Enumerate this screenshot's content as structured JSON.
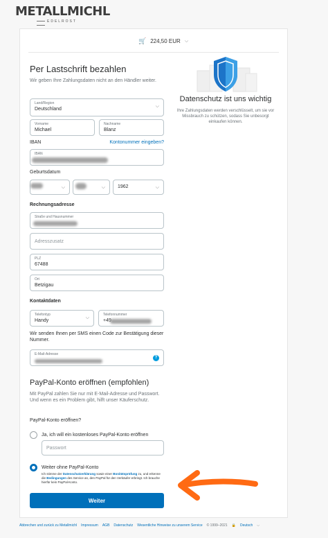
{
  "brand": {
    "name": "METALLMICHL",
    "tagline": "EDELROST"
  },
  "cart": {
    "amount": "224,50 EUR"
  },
  "form": {
    "title": "Per Lastschrift bezahlen",
    "intro": "Wir geben Ihre Zahlungsdaten nicht an den Händler weiter.",
    "country": {
      "label": "Land/Region",
      "value": "Deutschland"
    },
    "firstname": {
      "label": "Vorname",
      "value": "Michael"
    },
    "lastname": {
      "label": "Nachname",
      "value": "Blanz"
    },
    "iban_heading": "IBAN",
    "account_link": "Kontonummer eingeben?",
    "iban": {
      "label": "IBAN",
      "value": ""
    },
    "dob_heading": "Geburtsdatum",
    "dob_year": "1962",
    "billing_heading": "Rechnungsadresse",
    "street": {
      "label": "Straße und Hausnummer"
    },
    "address_extra": {
      "placeholder": "Adresszusatz"
    },
    "zip": {
      "label": "PLZ",
      "value": "67488"
    },
    "city": {
      "label": "Ort",
      "value": "Betzigau"
    },
    "contact_heading": "Kontaktdaten",
    "phone_type": {
      "label": "Telefontyp",
      "value": "Handy"
    },
    "phone_number": {
      "label": "Telefonnummer",
      "value": "+49"
    },
    "sms_note": "Wir senden Ihnen per SMS einen Code zur Bestätigung dieser Nummer.",
    "email": {
      "label": "E-Mail-Adresse"
    },
    "email_badge": "?"
  },
  "paypal": {
    "heading": "PayPal-Konto eröffnen (empfohlen)",
    "text": "Mit PayPal zahlen Sie nur mit E-Mail-Adresse und Passwort. Und wenn es ein Problem gibt, hilft unser Käuferschutz.",
    "question": "PayPal-Konto eröffnen?",
    "option_yes": "Ja, ich will ein kostenloses PayPal-Konto eröffnen",
    "password_placeholder": "Passwort",
    "option_no": "Weiter ohne PayPal-Konto",
    "legal_1": "Ich stimme der ",
    "legal_privacy": "Datenschutzerklärung",
    "legal_2": " sowie einer ",
    "legal_credit": "Bonitätsprüfung",
    "legal_3": " zu, und erkenne die ",
    "legal_terms": "Bedingungen",
    "legal_4": " des Service an, den PayPal für den Verkäufer erbringt. Ich brauche hierfür kein PayPal-Konto."
  },
  "submit_label": "Weiter",
  "privacy_panel": {
    "title": "Datenschutz ist uns wichtig",
    "text": "Ihre Zahlungsdaten werden verschlüsselt, um sie vor Missbrauch zu schützen, sodass Sie unbesorgt einkaufen können."
  },
  "footer": {
    "cancel": "Abbrechen und zurück zu Metallmichl",
    "imprint": "Impressum",
    "agb": "AGB",
    "privacy": "Datenschutz",
    "notices": "Wesentliche Hinweise zu unserem Service",
    "copyright": "© 1999–2021",
    "language": "Deutsch"
  },
  "colors": {
    "accent": "#0070ba",
    "annotation_arrow": "#ff6a13"
  }
}
